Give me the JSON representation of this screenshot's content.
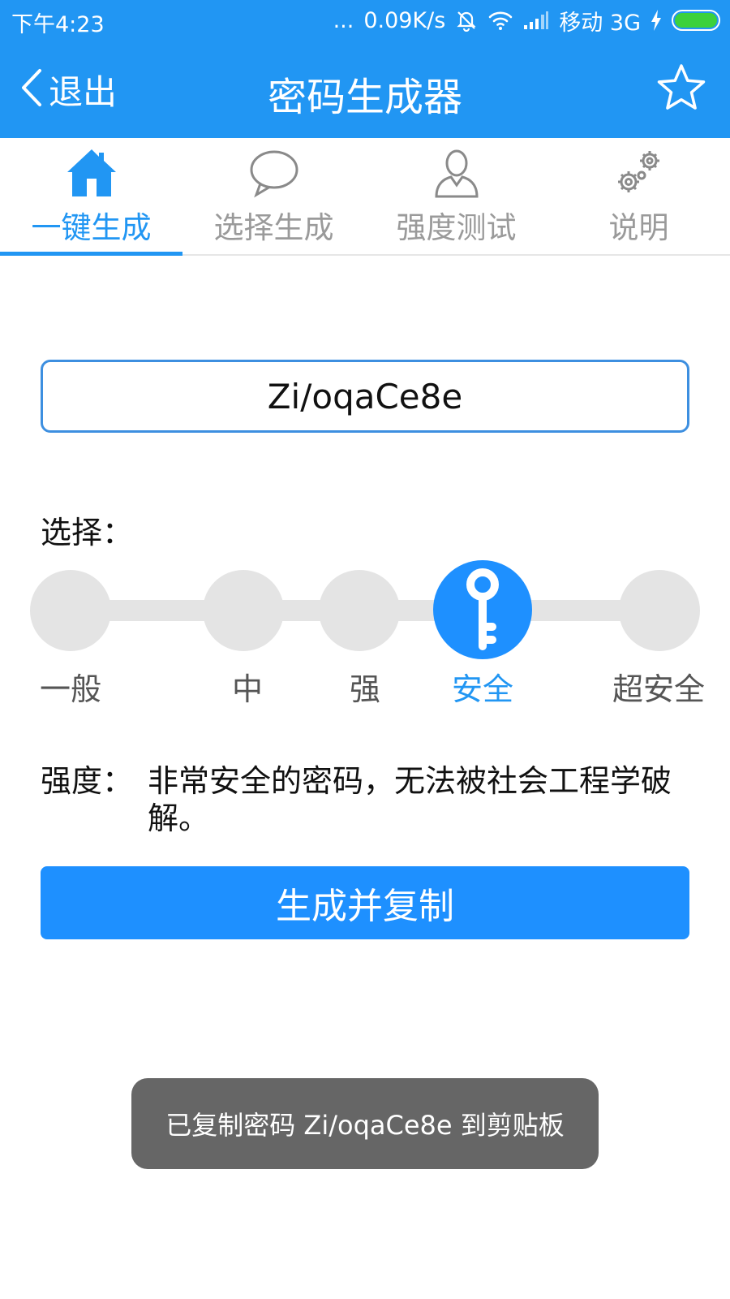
{
  "status_bar": {
    "time": "下午4:23",
    "dots": "...",
    "speed": "0.09K/s",
    "carrier": "移动 3G"
  },
  "app_bar": {
    "back_label": "退出",
    "title": "密码生成器"
  },
  "tabs": [
    {
      "label": "一键生成",
      "icon": "home-icon",
      "active": true
    },
    {
      "label": "选择生成",
      "icon": "chat-bubble-icon",
      "active": false
    },
    {
      "label": "强度测试",
      "icon": "user-icon",
      "active": false
    },
    {
      "label": "说明",
      "icon": "gears-icon",
      "active": false
    }
  ],
  "password": {
    "value": "Zi/oqaCe8e"
  },
  "selection": {
    "label": "选择：",
    "levels": [
      "一般",
      "中",
      "强",
      "安全",
      "超安全"
    ],
    "selected_index": 3
  },
  "strength": {
    "key": "强度：",
    "description": "非常安全的密码，无法被社会工程学破解。"
  },
  "generate_button": {
    "label": "生成并复制"
  },
  "toast": {
    "message": "已复制密码 Zi/oqaCe8e 到剪贴板"
  },
  "colors": {
    "primary": "#2196f3",
    "button": "#1e90ff",
    "inactive": "#e4e4e4",
    "toast_bg": "#666666",
    "battery": "#3cd13c"
  }
}
